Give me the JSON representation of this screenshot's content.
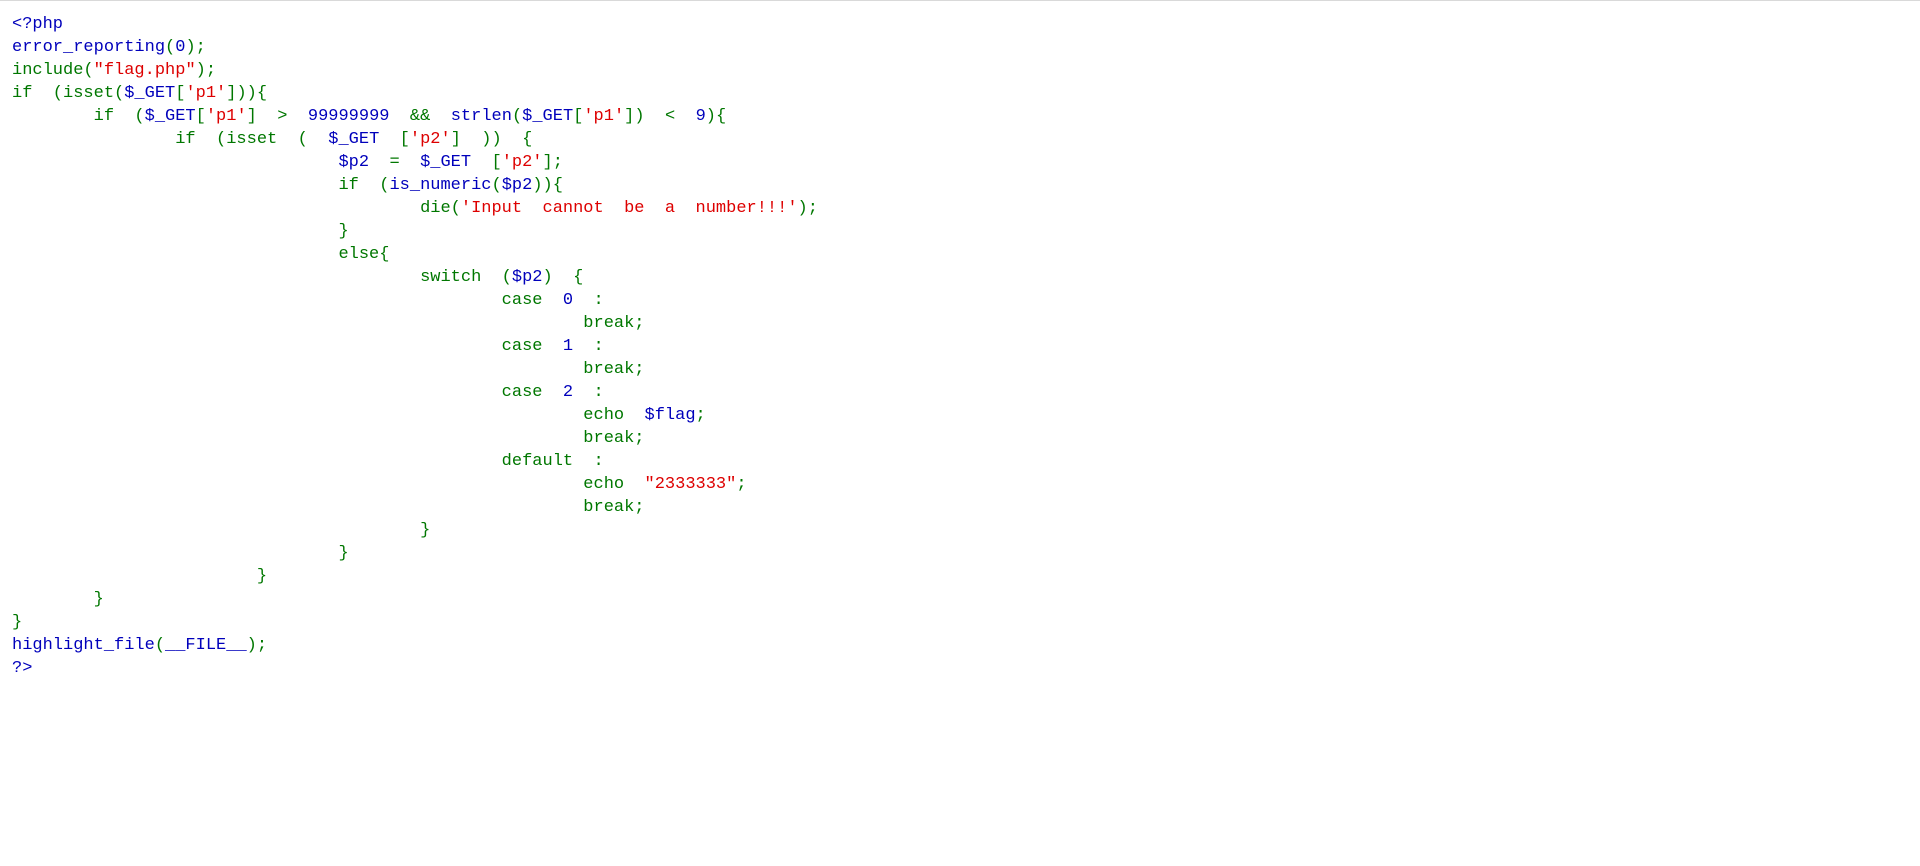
{
  "colors": {
    "default": "#0000BB",
    "keyword": "#007700",
    "string": "#DD0000",
    "background": "#FFFFFF"
  },
  "code_lines": [
    [
      [
        "d",
        "<?php"
      ]
    ],
    [
      [
        "d",
        "error_reporting"
      ],
      [
        "k",
        "("
      ],
      [
        "d",
        "0"
      ],
      [
        "k",
        ");"
      ]
    ],
    [
      [
        "k",
        "include("
      ],
      [
        "s",
        "\"flag.php\""
      ],
      [
        "k",
        ");"
      ]
    ],
    [
      [
        "k",
        "if  (isset("
      ],
      [
        "d",
        "$_GET"
      ],
      [
        "k",
        "["
      ],
      [
        "s",
        "'p1'"
      ],
      [
        "k",
        "])){"
      ]
    ],
    [
      [
        "k",
        "        if  ("
      ],
      [
        "d",
        "$_GET"
      ],
      [
        "k",
        "["
      ],
      [
        "s",
        "'p1'"
      ],
      [
        "k",
        "]  >  "
      ],
      [
        "d",
        "99999999"
      ],
      [
        "k",
        "  &&  "
      ],
      [
        "d",
        "strlen"
      ],
      [
        "k",
        "("
      ],
      [
        "d",
        "$_GET"
      ],
      [
        "k",
        "["
      ],
      [
        "s",
        "'p1'"
      ],
      [
        "k",
        "])  <  "
      ],
      [
        "d",
        "9"
      ],
      [
        "k",
        "){"
      ]
    ],
    [
      [
        "k",
        "                if  (isset  (  "
      ],
      [
        "d",
        "$_GET"
      ],
      [
        "k",
        "  ["
      ],
      [
        "s",
        "'p2'"
      ],
      [
        "k",
        "]  ))  {"
      ]
    ],
    [
      [
        "k",
        "                                "
      ],
      [
        "d",
        "$p2"
      ],
      [
        "k",
        "  =  "
      ],
      [
        "d",
        "$_GET"
      ],
      [
        "k",
        "  ["
      ],
      [
        "s",
        "'p2'"
      ],
      [
        "k",
        "];"
      ]
    ],
    [
      [
        "k",
        "                                if  ("
      ],
      [
        "d",
        "is_numeric"
      ],
      [
        "k",
        "("
      ],
      [
        "d",
        "$p2"
      ],
      [
        "k",
        ")){"
      ]
    ],
    [
      [
        "k",
        "                                        die("
      ],
      [
        "s",
        "'Input  cannot  be  a  number!!!'"
      ],
      [
        "k",
        ");"
      ]
    ],
    [
      [
        "k",
        "                                }"
      ]
    ],
    [
      [
        "k",
        "                                else{"
      ]
    ],
    [
      [
        "k",
        "                                        switch  ("
      ],
      [
        "d",
        "$p2"
      ],
      [
        "k",
        ")  {"
      ]
    ],
    [
      [
        "k",
        "                                                case  "
      ],
      [
        "d",
        "0"
      ],
      [
        "k",
        "  :"
      ]
    ],
    [
      [
        "k",
        "                                                        break;"
      ]
    ],
    [
      [
        "k",
        "                                                case  "
      ],
      [
        "d",
        "1"
      ],
      [
        "k",
        "  :"
      ]
    ],
    [
      [
        "k",
        "                                                        break;"
      ]
    ],
    [
      [
        "k",
        "                                                case  "
      ],
      [
        "d",
        "2"
      ],
      [
        "k",
        "  :"
      ]
    ],
    [
      [
        "k",
        "                                                        echo  "
      ],
      [
        "d",
        "$flag"
      ],
      [
        "k",
        ";"
      ]
    ],
    [
      [
        "k",
        "                                                        break;"
      ]
    ],
    [
      [
        "k",
        "                                                default  :"
      ]
    ],
    [
      [
        "k",
        "                                                        echo  "
      ],
      [
        "s",
        "\"2333333\""
      ],
      [
        "k",
        ";"
      ]
    ],
    [
      [
        "k",
        "                                                        break;"
      ]
    ],
    [
      [
        "k",
        "                                        }"
      ]
    ],
    [
      [
        "k",
        "                                }"
      ]
    ],
    [
      [
        "k",
        "                        }"
      ]
    ],
    [
      [
        "k",
        "        }"
      ]
    ],
    [
      [
        "k",
        "}"
      ]
    ],
    [
      [
        "d",
        "highlight_file"
      ],
      [
        "k",
        "("
      ],
      [
        "d",
        "__FILE__"
      ],
      [
        "k",
        ");"
      ]
    ],
    [
      [
        "d",
        "?>"
      ]
    ]
  ]
}
